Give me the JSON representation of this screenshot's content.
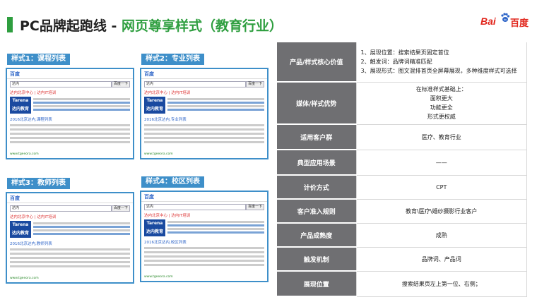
{
  "header": {
    "title_main": "PC品牌起跑线 - ",
    "title_accent": "网页尊享样式（教育行业）",
    "logo_text_left": "Bai",
    "logo_text_right": "百度",
    "logo_mark": "du"
  },
  "shots": [
    {
      "label": "样式1：课程列表",
      "section": "2016北京达内,课程列表"
    },
    {
      "label": "样式2：专业列表",
      "section": "2016北京达内,专业列表"
    },
    {
      "label": "样式3：教师列表",
      "section": "2016北京达内,教师列表"
    },
    {
      "label": "样式4：校区列表",
      "section": "2016北京达内,校区列表"
    }
  ],
  "mock": {
    "search_value": "达内",
    "search_button": "百度一下",
    "ad_title": "达内北京中心 | 达内IT培训",
    "brand": "Tarena",
    "brand_sub": "达内教育",
    "url": "www.tgeeora.com"
  },
  "table": {
    "rows": [
      {
        "key": "产品/样式核心价值",
        "value": [
          "1、展现位置：搜索结果页固定首位",
          "2、触发词：品牌词精准匹配",
          "3、展现形式：图文混排首页全屏幕展现，多种维度样式可选择"
        ]
      },
      {
        "key": "媒体/样式优势",
        "value": [
          "在标准样式基础上：",
          "面积更大",
          "功能更全",
          "形式更权威"
        ]
      },
      {
        "key": "适用客户群",
        "value": [
          "医疗、教育行业"
        ]
      },
      {
        "key": "典型应用场景",
        "value": [
          "——"
        ]
      },
      {
        "key": "计价方式",
        "value": [
          "CPT"
        ]
      },
      {
        "key": "客户准入规则",
        "value": [
          "教育\\医疗\\婚纱摄影行业客户"
        ]
      },
      {
        "key": "产品成熟度",
        "value": [
          "成熟"
        ]
      },
      {
        "key": "触发机制",
        "value": [
          "品牌词、产品词"
        ]
      },
      {
        "key": "展现位置",
        "value": [
          "搜索结果页左上第一位、右侧；"
        ]
      }
    ]
  }
}
